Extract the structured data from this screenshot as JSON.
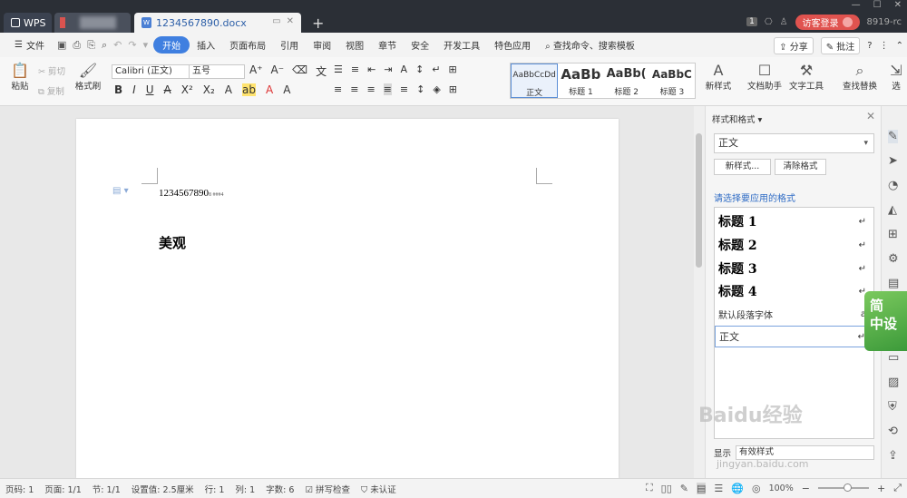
{
  "titlebar": {
    "wps_tab": "WPS",
    "doc_tab": "1234567890.docx",
    "visitor_login": "访客登录",
    "user_id": "8919-rc",
    "badge": "1"
  },
  "menu": {
    "file": "文件",
    "tabs": [
      "开始",
      "插入",
      "页面布局",
      "引用",
      "审阅",
      "视图",
      "章节",
      "安全",
      "开发工具",
      "特色应用"
    ],
    "search": "查找命令、搜索模板",
    "share": "分享",
    "comment": "批注"
  },
  "ribbon": {
    "paste": "粘贴",
    "cut": "剪切",
    "copy": "复制",
    "format_painter": "格式刷",
    "font_name": "Calibri (正文)",
    "font_size": "五号",
    "styles": [
      {
        "preview": "AaBbCcDd",
        "label": "正文"
      },
      {
        "preview": "AaBb",
        "label": "标题 1"
      },
      {
        "preview": "AaBb(",
        "label": "标题 2"
      },
      {
        "preview": "AaBbC",
        "label": "标题 3"
      }
    ],
    "new_style": "新样式",
    "doc_assistant": "文档助手",
    "text_tools": "文字工具",
    "find_replace": "查找替换",
    "select": "选"
  },
  "document": {
    "line1": "1234567890",
    "line1_sub": "8 ###4",
    "line2": "美观"
  },
  "panel": {
    "title": "样式和格式",
    "current_style": "正文",
    "new_style_btn": "新样式...",
    "clear_format_btn": "清除格式",
    "apply_label": "请选择要应用的格式",
    "styles": [
      {
        "name": "标题 1",
        "mark": "↵"
      },
      {
        "name": "标题 2",
        "mark": "↵"
      },
      {
        "name": "标题 3",
        "mark": "↵"
      },
      {
        "name": "标题 4",
        "mark": "↵"
      },
      {
        "name": "默认段落字体",
        "mark": "a"
      },
      {
        "name": "正文",
        "mark": "↵"
      }
    ],
    "show_label": "显示",
    "show_value": "有效样式"
  },
  "side_ad": {
    "line1": "简",
    "line2": "中设"
  },
  "status": {
    "page": "页码: 1",
    "pages": "页面: 1/1",
    "section": "节: 1/1",
    "setting": "设置值: 2.5厘米",
    "row": "行: 1",
    "col": "列: 1",
    "words": "字数: 6",
    "spell": "拼写检查",
    "cert": "未认证",
    "zoom": "100%"
  },
  "watermark": {
    "line1": "Baidu经验",
    "line2": "jingyan.baidu.com"
  }
}
